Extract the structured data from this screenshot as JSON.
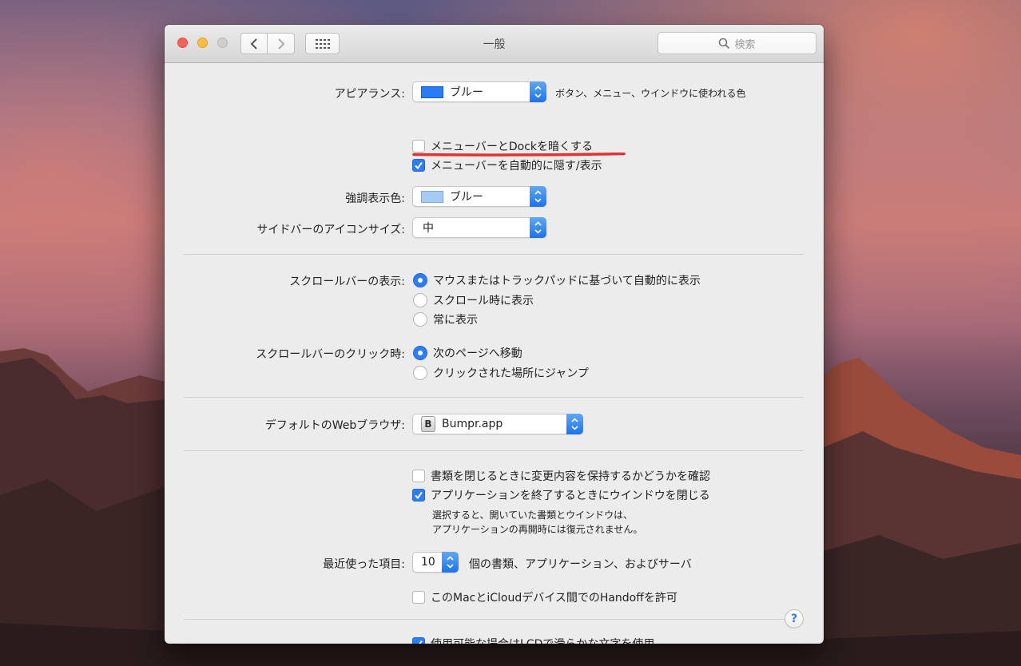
{
  "window": {
    "title": "一般"
  },
  "toolbar": {
    "search_placeholder": "検索"
  },
  "appearance": {
    "label": "アピアランス:",
    "value": "ブルー",
    "swatch_color": "#2a7cf5",
    "note": "ボタン、メニュー、ウインドウに使われる色"
  },
  "checks_top": [
    {
      "label": "メニューバーとDockを暗くする",
      "checked": false
    },
    {
      "label": "メニューバーを自動的に隠す/表示",
      "checked": true
    }
  ],
  "highlight": {
    "label": "強調表示色:",
    "value": "ブルー",
    "swatch_color": "#a7c9f5"
  },
  "sidebar_icon": {
    "label": "サイドバーのアイコンサイズ:",
    "value": "中"
  },
  "scrollbars": {
    "label": "スクロールバーの表示:",
    "options": [
      {
        "label": "マウスまたはトラックパッドに基づいて自動的に表示",
        "selected": true
      },
      {
        "label": "スクロール時に表示",
        "selected": false
      },
      {
        "label": "常に表示",
        "selected": false
      }
    ]
  },
  "scroll_click": {
    "label": "スクロールバーのクリック時:",
    "options": [
      {
        "label": "次のページへ移動",
        "selected": true
      },
      {
        "label": "クリックされた場所にジャンプ",
        "selected": false
      }
    ]
  },
  "browser": {
    "label": "デフォルトのWebブラウザ:",
    "icon_letter": "B",
    "value": "Bumpr.app"
  },
  "checks_docs": [
    {
      "label": "書類を閉じるときに変更内容を保持するかどうかを確認",
      "checked": false
    },
    {
      "label": "アプリケーションを終了するときにウインドウを閉じる",
      "checked": true
    }
  ],
  "docs_note": {
    "line1": "選択すると、開いていた書類とウインドウは、",
    "line2": "アプリケーションの再開時には復元されません。"
  },
  "recent": {
    "label": "最近使った項目:",
    "value": "10",
    "suffix": "個の書類、アプリケーション、およびサーバ"
  },
  "handoff": {
    "label": "このMacとiCloudデバイス間でのHandoffを許可",
    "checked": false
  },
  "lcd": {
    "label": "使用可能な場合はLCDで滑らかな文字を使用",
    "checked": true
  },
  "help": {
    "label": "?"
  },
  "colors": {
    "accent": "#2e7cf6",
    "annotation": "#e2322f"
  }
}
